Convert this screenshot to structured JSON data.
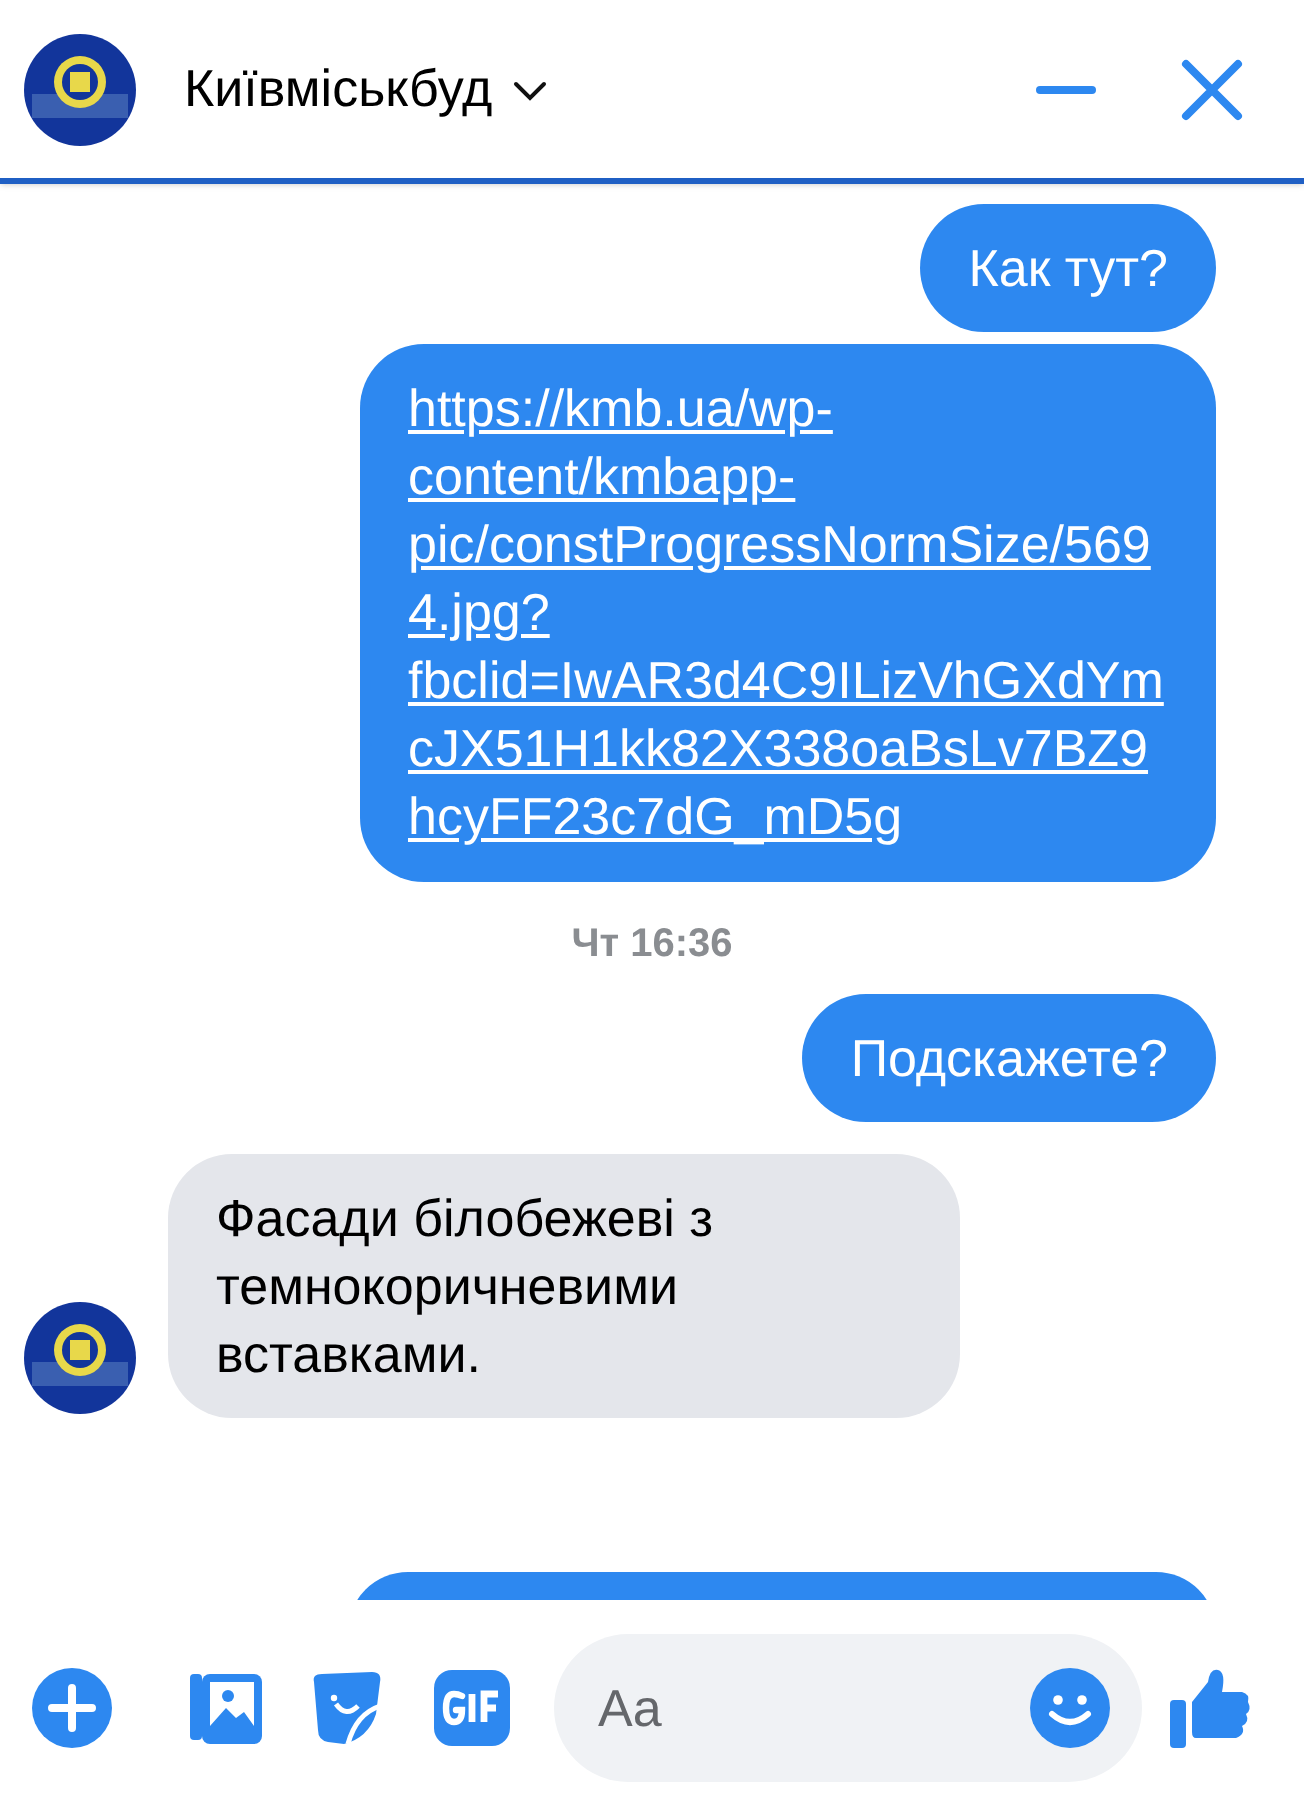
{
  "header": {
    "title": "Київміськбуд"
  },
  "messages": [
    {
      "outgoing": true,
      "kind": "text",
      "text": "Как тут?"
    },
    {
      "outgoing": true,
      "kind": "link",
      "text": "https://kmb.ua/wp-content/kmbapp-pic/constProgressNormSize/5694.jpg?fbclid=IwAR3d4C9ILizVhGXdYmcJX51H1kk82X338oaBsLv7BZ9hcyFF23c7dG_mD5g"
    },
    {
      "kind": "timestamp",
      "text": "Чт 16:36"
    },
    {
      "outgoing": true,
      "kind": "text",
      "text": "Подскажете?"
    },
    {
      "outgoing": false,
      "kind": "text",
      "text": "Фасади білобежеві з темнокоричневими вставками."
    },
    {
      "outgoing": true,
      "kind": "cut"
    }
  ],
  "composer": {
    "placeholder": "Aa"
  }
}
